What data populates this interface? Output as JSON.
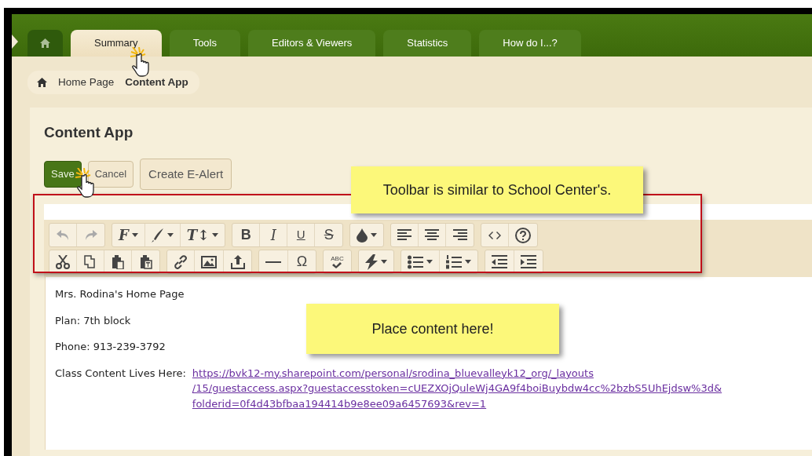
{
  "tabs": [
    {
      "kind": "home",
      "selected": false
    },
    {
      "label": "Summary",
      "selected": true
    },
    {
      "label": "Tools",
      "selected": false
    },
    {
      "label": "Editors & Viewers",
      "selected": false
    },
    {
      "label": "Statistics",
      "selected": false
    },
    {
      "label": "How do I...?",
      "selected": false
    }
  ],
  "breadcrumb": [
    {
      "kind": "home"
    },
    {
      "label": "Home Page",
      "current": false
    },
    {
      "label": "Content App",
      "current": true
    }
  ],
  "page_title": "Content App",
  "buttons": [
    {
      "label": "Save",
      "primary": true
    },
    {
      "label": "Cancel",
      "primary": false
    },
    {
      "label": "Create E-Alert",
      "primary": false
    }
  ],
  "toolbar_rows": [
    [
      [
        {
          "kind": "icon",
          "disabled": true,
          "dropdown": false
        },
        {
          "kind": "icon",
          "disabled": true,
          "dropdown": false
        }
      ],
      [
        {
          "kind": "glyph",
          "glyph": "F",
          "disabled": false,
          "dropdown": true
        },
        {
          "kind": "icon",
          "disabled": false,
          "dropdown": true
        },
        {
          "kind": "glyph",
          "glyph": "T↕",
          "disabled": false,
          "dropdown": true
        }
      ],
      [
        {
          "kind": "glyph",
          "glyph": "B",
          "disabled": false,
          "dropdown": false
        },
        {
          "kind": "glyph",
          "glyph": "I",
          "disabled": false,
          "dropdown": false
        },
        {
          "kind": "glyph",
          "glyph": "U",
          "disabled": false,
          "dropdown": false
        },
        {
          "kind": "glyph",
          "glyph": "S",
          "disabled": false,
          "dropdown": false
        }
      ],
      [
        {
          "kind": "icon",
          "disabled": false,
          "dropdown": true
        }
      ],
      [
        {
          "kind": "icon",
          "disabled": false,
          "dropdown": false
        },
        {
          "kind": "icon",
          "disabled": false,
          "dropdown": false
        },
        {
          "kind": "icon",
          "disabled": false,
          "dropdown": false
        }
      ],
      [
        {
          "kind": "icon",
          "disabled": false,
          "dropdown": false
        },
        {
          "kind": "icon",
          "disabled": false,
          "dropdown": false
        }
      ]
    ],
    [
      [
        {
          "kind": "icon",
          "disabled": false,
          "dropdown": false
        },
        {
          "kind": "icon",
          "disabled": false,
          "dropdown": false
        },
        {
          "kind": "icon",
          "disabled": false,
          "dropdown": false
        },
        {
          "kind": "icon",
          "disabled": false,
          "dropdown": false
        }
      ],
      [
        {
          "kind": "icon",
          "disabled": false,
          "dropdown": false
        },
        {
          "kind": "icon",
          "disabled": false,
          "dropdown": false
        },
        {
          "kind": "icon",
          "disabled": false,
          "dropdown": false
        }
      ],
      [
        {
          "kind": "icon",
          "disabled": false,
          "dropdown": false
        },
        {
          "kind": "glyph",
          "glyph": "Ω",
          "disabled": false,
          "dropdown": false
        }
      ],
      [
        {
          "kind": "check",
          "glyph": "ABC",
          "disabled": false,
          "dropdown": false
        }
      ],
      [
        {
          "kind": "icon",
          "disabled": false,
          "dropdown": true
        }
      ],
      [
        {
          "kind": "icon",
          "disabled": false,
          "dropdown": true
        },
        {
          "kind": "icon",
          "disabled": false,
          "dropdown": true
        }
      ],
      [
        {
          "kind": "icon",
          "disabled": false,
          "dropdown": false
        },
        {
          "kind": "icon",
          "disabled": false,
          "dropdown": false
        }
      ]
    ]
  ],
  "content": [
    {
      "kind": "text",
      "text": "Mrs. Rodina's Home Page"
    },
    {
      "kind": "text",
      "text": "Plan: 7th block"
    },
    {
      "kind": "text",
      "text": "Phone: 913-239-3792"
    },
    {
      "kind": "link",
      "text": "Class Content Lives Here:",
      "link_lines": [
        "https://bvk12-my.sharepoint.com/personal/srodina_bluevalleyk12_org/_layouts",
        "/15/guestaccess.aspx?guestaccesstoken=cUEZXOjQuleWj4GA9f4boiBuybdw4cc%2bzbS5UhEjdsw%3d&",
        "folderid=0f4d43bfbaa194414b9e8ee09a6457693&rev=1"
      ]
    }
  ],
  "callouts": [
    "Toolbar is similar to School Center's.",
    "Place content here!"
  ]
}
